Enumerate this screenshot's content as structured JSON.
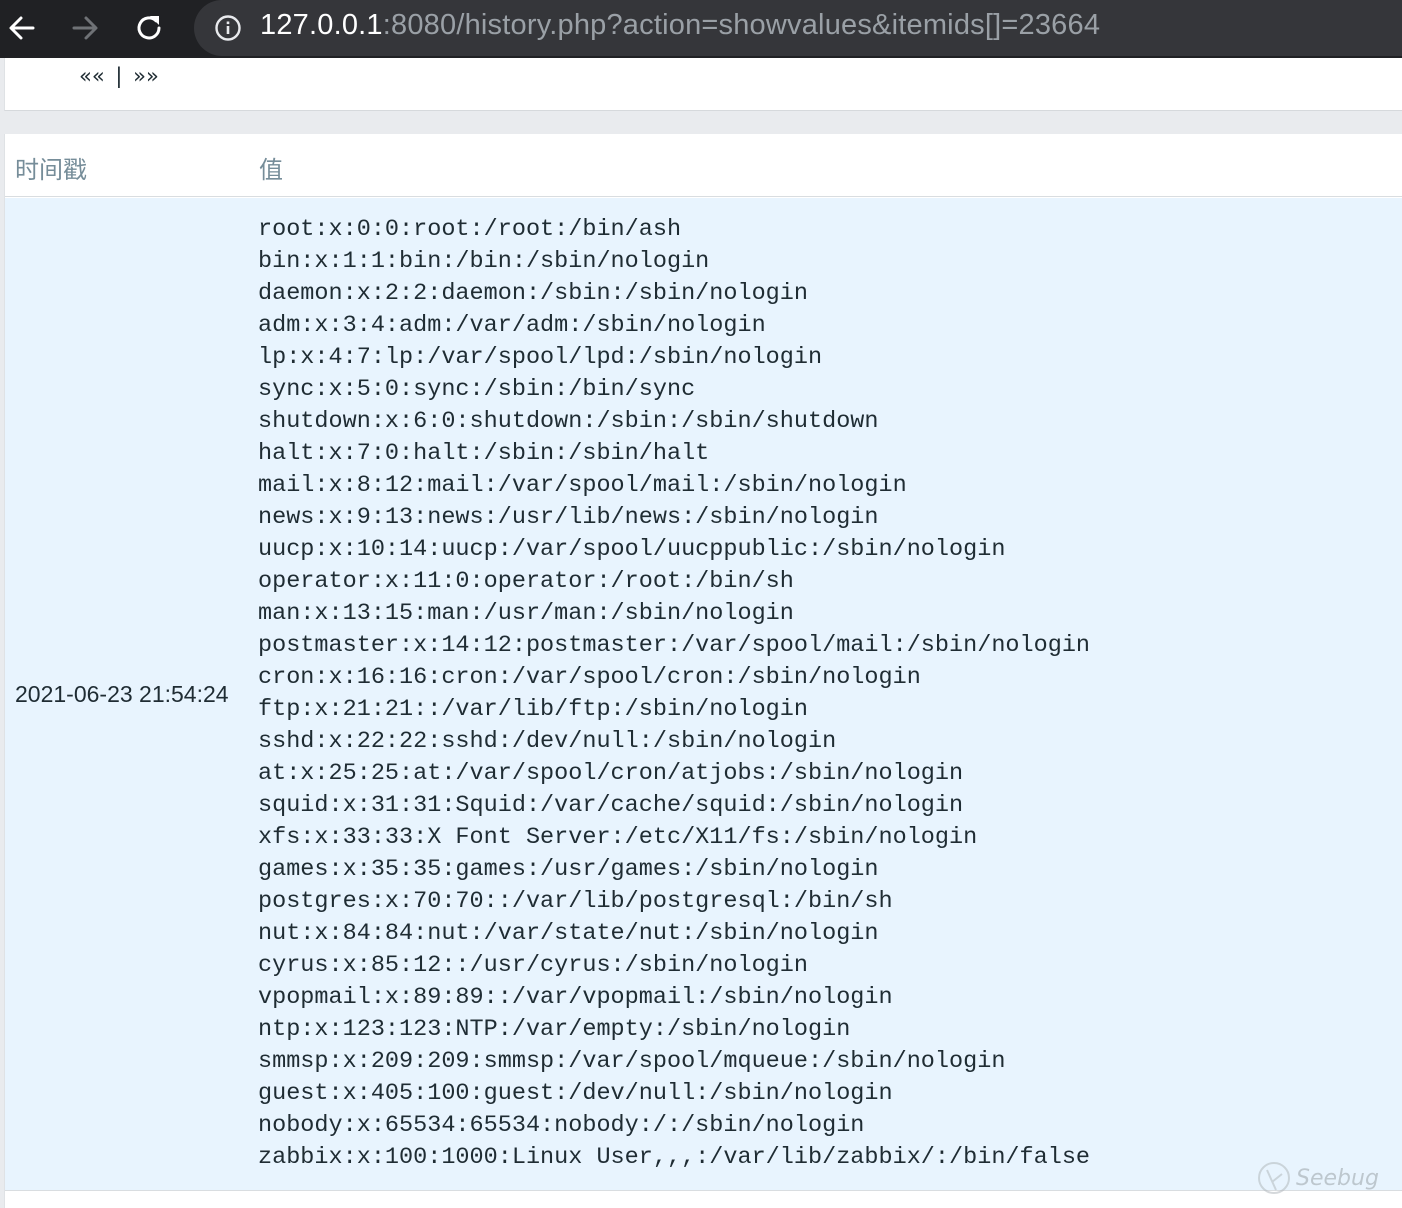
{
  "browser": {
    "url_host": "127.0.0.1",
    "url_rest": ":8080/history.php?action=showvalues&itemids[]=23664"
  },
  "pager": {
    "prev": "««",
    "separator": "|",
    "next": "»»"
  },
  "table": {
    "headers": {
      "timestamp": "时间戳",
      "value": "值"
    },
    "rows": [
      {
        "timestamp": "2021-06-23 21:54:24",
        "value": "root:x:0:0:root:/root:/bin/ash\nbin:x:1:1:bin:/bin:/sbin/nologin\ndaemon:x:2:2:daemon:/sbin:/sbin/nologin\nadm:x:3:4:adm:/var/adm:/sbin/nologin\nlp:x:4:7:lp:/var/spool/lpd:/sbin/nologin\nsync:x:5:0:sync:/sbin:/bin/sync\nshutdown:x:6:0:shutdown:/sbin:/sbin/shutdown\nhalt:x:7:0:halt:/sbin:/sbin/halt\nmail:x:8:12:mail:/var/spool/mail:/sbin/nologin\nnews:x:9:13:news:/usr/lib/news:/sbin/nologin\nuucp:x:10:14:uucp:/var/spool/uucppublic:/sbin/nologin\noperator:x:11:0:operator:/root:/bin/sh\nman:x:13:15:man:/usr/man:/sbin/nologin\npostmaster:x:14:12:postmaster:/var/spool/mail:/sbin/nologin\ncron:x:16:16:cron:/var/spool/cron:/sbin/nologin\nftp:x:21:21::/var/lib/ftp:/sbin/nologin\nsshd:x:22:22:sshd:/dev/null:/sbin/nologin\nat:x:25:25:at:/var/spool/cron/atjobs:/sbin/nologin\nsquid:x:31:31:Squid:/var/cache/squid:/sbin/nologin\nxfs:x:33:33:X Font Server:/etc/X11/fs:/sbin/nologin\ngames:x:35:35:games:/usr/games:/sbin/nologin\npostgres:x:70:70::/var/lib/postgresql:/bin/sh\nnut:x:84:84:nut:/var/state/nut:/sbin/nologin\ncyrus:x:85:12::/usr/cyrus:/sbin/nologin\nvpopmail:x:89:89::/var/vpopmail:/sbin/nologin\nntp:x:123:123:NTP:/var/empty:/sbin/nologin\nsmmsp:x:209:209:smmsp:/var/spool/mqueue:/sbin/nologin\nguest:x:405:100:guest:/dev/null:/sbin/nologin\nnobody:x:65534:65534:nobody:/:/sbin/nologin\nzabbix:x:100:1000:Linux User,,,:/var/lib/zabbix/:/bin/false"
      }
    ]
  },
  "watermark": {
    "text": "Seebug"
  },
  "icons": {
    "back": "arrow-left-icon",
    "forward": "arrow-right-icon",
    "reload": "reload-icon",
    "site_info": "info-circle-icon"
  }
}
